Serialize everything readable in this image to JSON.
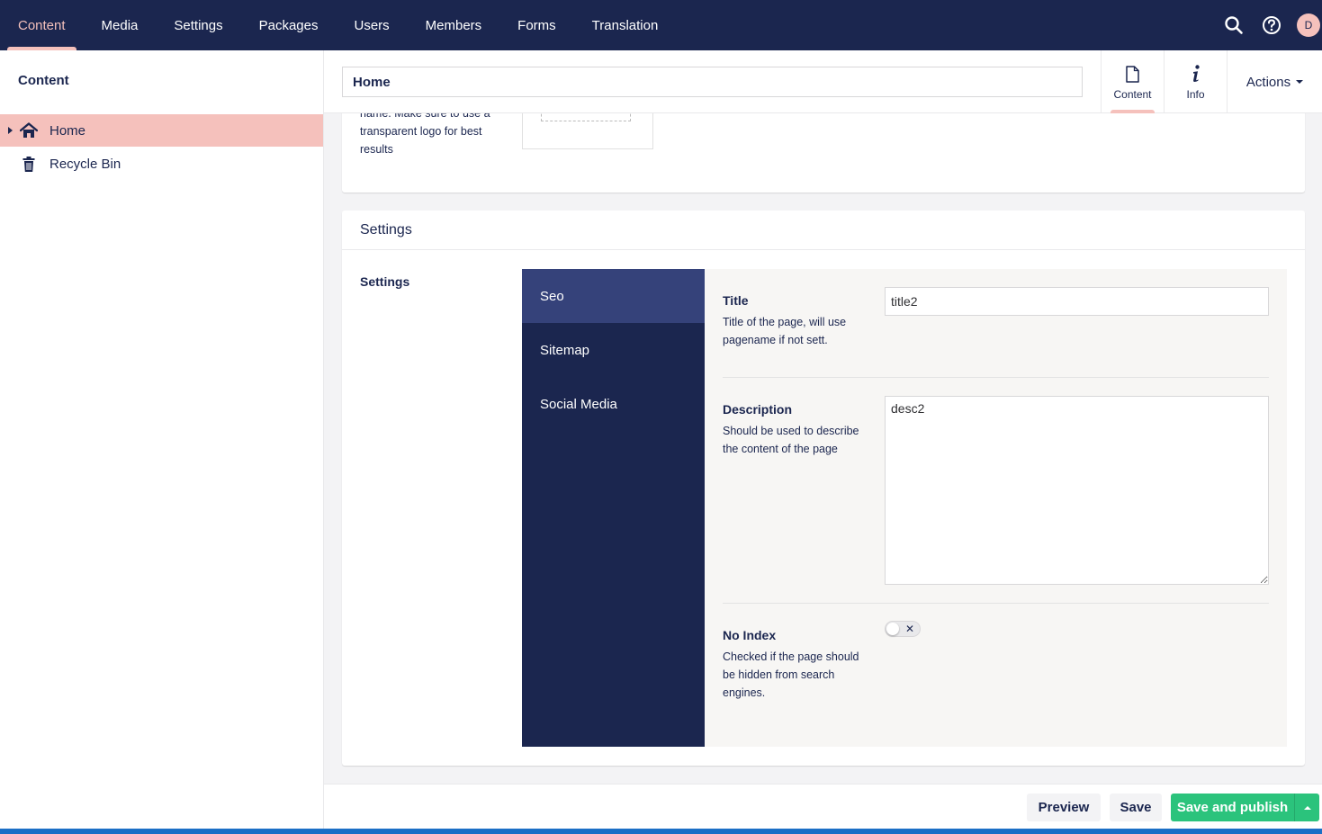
{
  "topnav": {
    "items": [
      {
        "label": "Content",
        "active": true
      },
      {
        "label": "Media"
      },
      {
        "label": "Settings"
      },
      {
        "label": "Packages"
      },
      {
        "label": "Users"
      },
      {
        "label": "Members"
      },
      {
        "label": "Forms"
      },
      {
        "label": "Translation"
      }
    ],
    "avatar_initial": "D",
    "tools": [
      "search-icon",
      "help-icon"
    ]
  },
  "sidebar": {
    "title": "Content",
    "tree": [
      {
        "label": "Home",
        "icon": "home-icon",
        "selected": true
      },
      {
        "label": "Recycle Bin",
        "icon": "trash-icon"
      }
    ]
  },
  "header": {
    "node_name": "Home",
    "apps": [
      {
        "label": "Content",
        "icon": "document-icon",
        "active": true
      },
      {
        "label": "Info",
        "icon": "info-icon"
      }
    ],
    "actions_label": "Actions"
  },
  "logo_property": {
    "description": "name. Make sure to use a transparent logo for best results"
  },
  "settings_panel": {
    "title": "Settings",
    "property_label": "Settings",
    "tabs": [
      {
        "label": "Seo",
        "active": true
      },
      {
        "label": "Sitemap"
      },
      {
        "label": "Social Media"
      }
    ],
    "fields": {
      "title": {
        "label": "Title",
        "description": "Title of the page, will use pagename if not sett.",
        "value": "title2"
      },
      "description": {
        "label": "Description",
        "description": "Should be used to describe the content of the page",
        "value": "desc2"
      },
      "no_index": {
        "label": "No Index",
        "description": "Checked if the page should be hidden from search engines.",
        "checked": false,
        "toggle_glyph": "✕"
      }
    }
  },
  "footer": {
    "preview_label": "Preview",
    "save_label": "Save",
    "publish_label": "Save and publish"
  },
  "colors": {
    "nav_bg": "#1b264f",
    "accent": "#f5c1bc",
    "publish": "#2bc37c"
  }
}
